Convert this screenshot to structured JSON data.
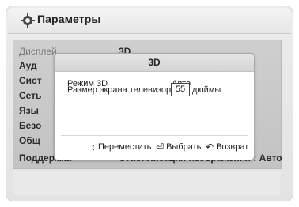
{
  "header": {
    "title": "Параметры"
  },
  "menu": {
    "items": [
      {
        "label": "Дисплей",
        "dim": true
      },
      {
        "label": "Ауд",
        "dim": false
      },
      {
        "label": "Сист",
        "dim": false
      },
      {
        "label": "Сеть",
        "dim": false
      },
      {
        "label": "Язы",
        "dim": false
      },
      {
        "label": "Безо",
        "dim": false
      },
      {
        "label": "Общ",
        "dim": false
      },
      {
        "label": "Поддержка",
        "dim": false
      }
    ],
    "right_top": "3D",
    "right_bottom": "Стабилизация изображения : Авто"
  },
  "dialog": {
    "title": "3D",
    "mode_label": "Режим 3D",
    "mode_value": ": Авто",
    "size_label": "Размер экрана телевизора :",
    "size_value": "55",
    "size_unit": "дюймы",
    "nav_move": "Переместить",
    "nav_select": "Выбрать",
    "nav_back": "Возврат"
  }
}
